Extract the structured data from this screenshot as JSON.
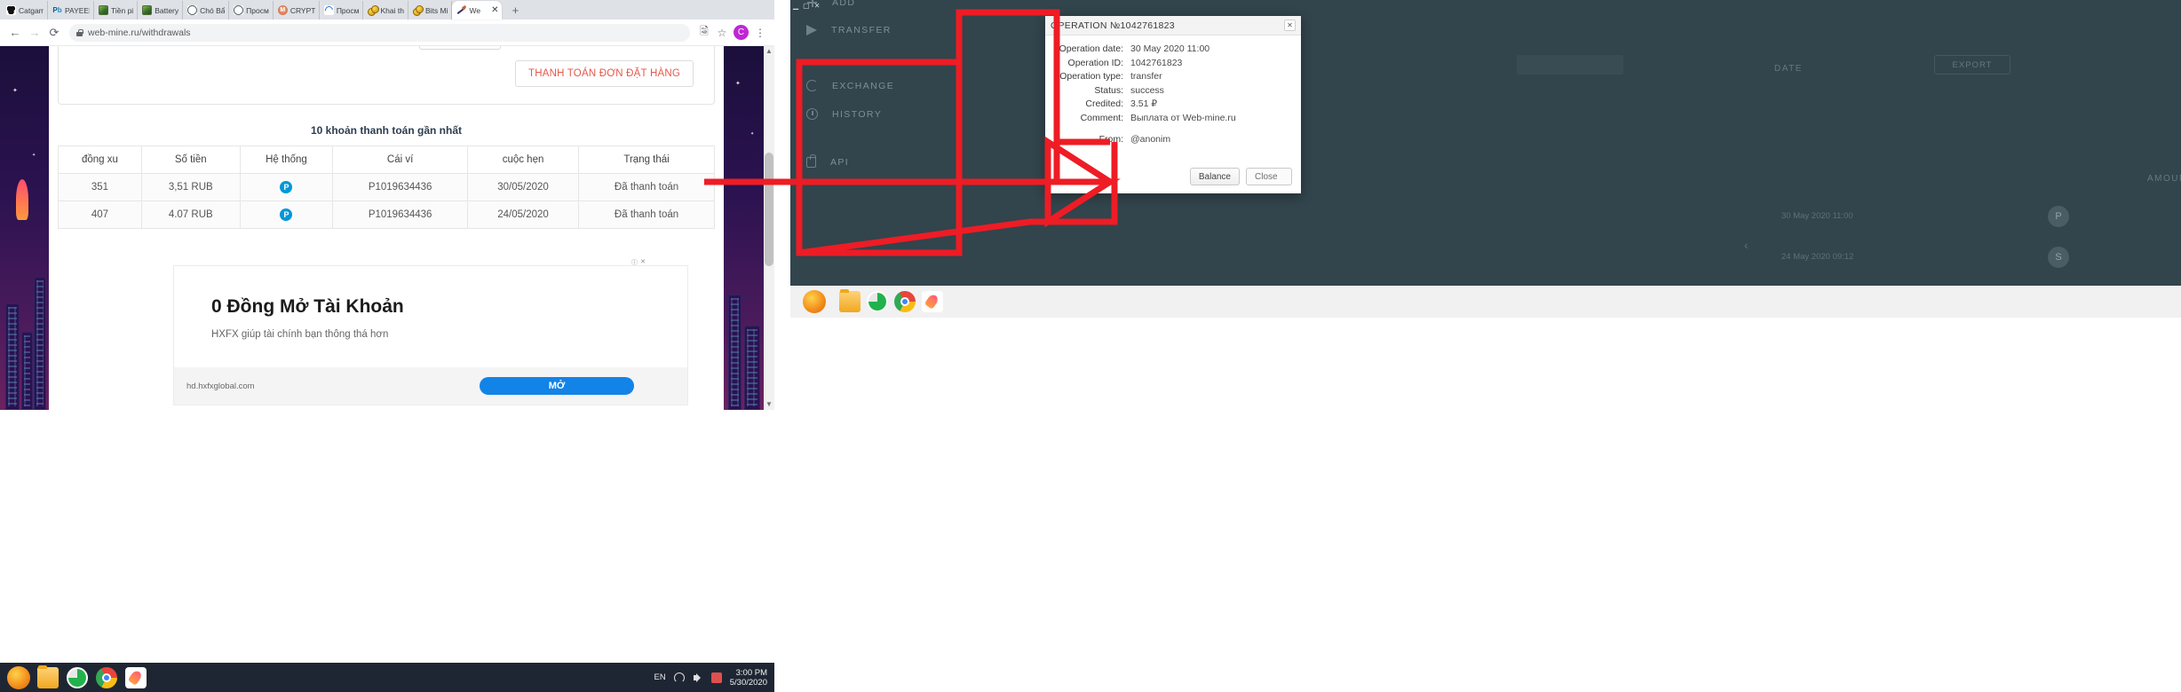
{
  "browser": {
    "tabs": [
      {
        "title": "Catgam",
        "icon": "cat-paw-icon"
      },
      {
        "title": "PAYEER",
        "icon": "payeer-icon"
      },
      {
        "title": "Tiền pi",
        "icon": "image-thumbnail-icon"
      },
      {
        "title": "Battery",
        "icon": "image-thumbnail-icon"
      },
      {
        "title": "Chó Bẩ",
        "icon": "globe-icon"
      },
      {
        "title": "Просм",
        "icon": "globe-icon"
      },
      {
        "title": "CRYPTO",
        "icon": "monero-icon"
      },
      {
        "title": "Просм",
        "icon": "loading-spinner-icon"
      },
      {
        "title": "Khai th",
        "icon": "coins-icon"
      },
      {
        "title": "Bits Mi",
        "icon": "coins-icon"
      },
      {
        "title": "We",
        "icon": "pickaxe-icon",
        "active": true
      }
    ],
    "new_tab_label": "+",
    "tab_close_label": "✕",
    "nav": {
      "back": "←",
      "forward": "→",
      "reload": "⟳"
    },
    "url": "web-mine.ru/withdrawals",
    "omnibox_icons": [
      "lock-icon"
    ],
    "toolbar_icons": [
      "translate-icon",
      "bookmark-star-icon",
      "browser-menu-icon"
    ],
    "avatar_letter": "C"
  },
  "page": {
    "pay_order_button": "THANH TOÁN ĐƠN ĐẶT HÀNG",
    "recent_heading": "10 khoản thanh toán gần nhất",
    "table": {
      "columns": [
        "đồng xu",
        "Số tiền",
        "Hệ thống",
        "Cái ví",
        "cuộc hẹn",
        "Trạng thái"
      ],
      "rows": [
        {
          "coin": "351",
          "amount": "3,51 RUB",
          "system": "P",
          "wallet": "P1019634436",
          "date": "30/05/2020",
          "status": "Đã thanh toán"
        },
        {
          "coin": "407",
          "amount": "4.07 RUB",
          "system": "P",
          "wallet": "P1019634436",
          "date": "24/05/2020",
          "status": "Đã thanh toán"
        }
      ]
    },
    "ad": {
      "marker": "ⓘ",
      "close": "✕",
      "title": "0 Đồng Mở Tài Khoản",
      "subtitle": "HXFX giúp tài chính bạn thông thá hơn",
      "domain": "hd.hxfxglobal.com",
      "cta": "MỞ"
    }
  },
  "taskbar": {
    "apps": [
      "start-orb-icon",
      "folder-icon",
      "green-app-icon",
      "chrome-icon",
      "rocket-app-icon"
    ],
    "language": "EN",
    "tray_icons": [
      "wifi-icon",
      "volume-icon",
      "security-icon"
    ],
    "clock_time": "3:00 PM",
    "clock_date": "5/30/2020"
  },
  "right_app": {
    "window_controls": [
      "minimize",
      "maximize",
      "close"
    ],
    "sidebar": [
      {
        "label": "ADD",
        "icon": "plus-icon"
      },
      {
        "label": "TRANSFER",
        "icon": "send-icon"
      },
      {
        "label": "EXCHANGE",
        "icon": "exchange-icon"
      },
      {
        "label": "HISTORY",
        "icon": "history-icon"
      },
      {
        "label": "API",
        "icon": "api-icon"
      }
    ],
    "content": {
      "date_label": "DATE",
      "export_label": "EXPORT",
      "amount_label": "AMOUNT",
      "rows": [
        {
          "date": "30 May 2020 11:00",
          "badge": "P"
        },
        {
          "date": "24 May 2020 09:12",
          "badge": "S"
        }
      ],
      "prev_label": "‹"
    }
  },
  "operation_dialog": {
    "title": "OPERATION №1042761823",
    "close_label": "✕",
    "fields": [
      {
        "key": "Operation date:",
        "value": "30 May 2020 11:00"
      },
      {
        "key": "Operation ID:",
        "value": "1042761823"
      },
      {
        "key": "Operation type:",
        "value": "transfer"
      },
      {
        "key": "Status:",
        "value": "success"
      },
      {
        "key": "Credited:",
        "value": "3.51 ₽"
      },
      {
        "key": "Comment:",
        "value": "Выплата от Web-mine.ru"
      }
    ],
    "from_key": "From:",
    "from_value": "@anonim",
    "balance_button": "Balance",
    "close_button": "Close"
  },
  "colors": {
    "accent_red": "#e8564a",
    "annotation_red": "#ee1c25",
    "payeer_blue": "#0097d7",
    "ad_blue": "#1283e7",
    "chrome_tabbar": "#dee1e6",
    "right_bg": "#32444c"
  }
}
